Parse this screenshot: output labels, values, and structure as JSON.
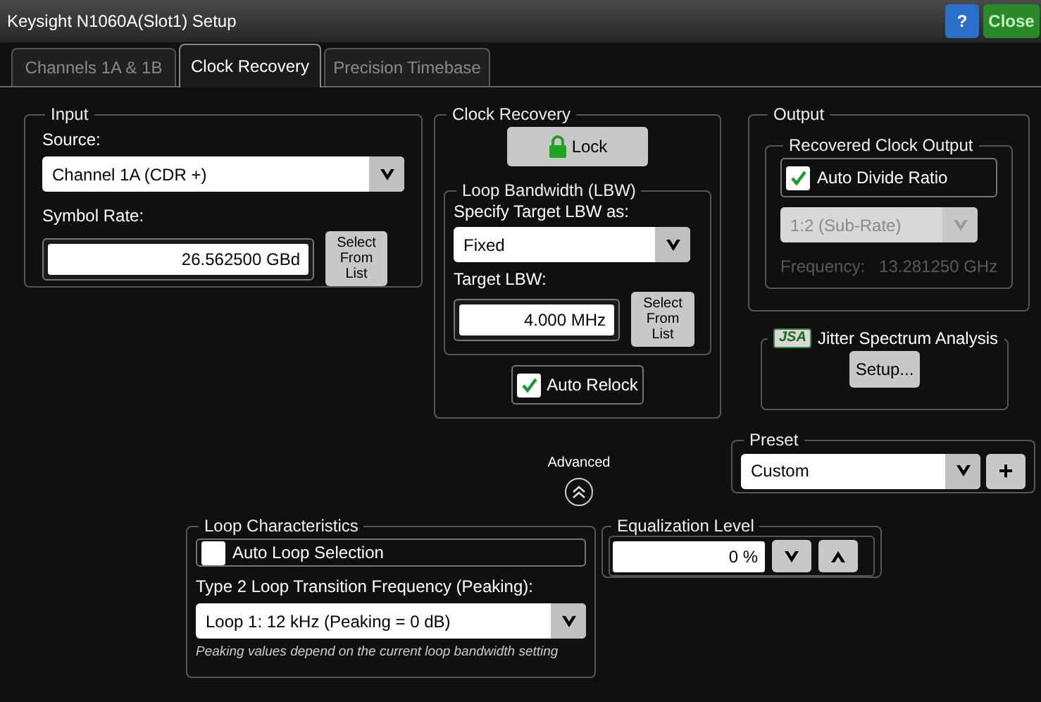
{
  "window": {
    "title": "Keysight N1060A(Slot1) Setup"
  },
  "title_buttons": [
    {
      "kind": "help",
      "label": "?"
    },
    {
      "kind": "close",
      "label": "Close"
    }
  ],
  "tabs": [
    {
      "label": "Channels 1A & 1B",
      "selected": false
    },
    {
      "label": "Clock Recovery",
      "selected": true
    },
    {
      "label": "Precision Timebase",
      "selected": false
    }
  ],
  "input": {
    "title": "Input",
    "source_label": "Source:",
    "source": "Channel 1A (CDR +)",
    "symbol_rate_label": "Symbol Rate:",
    "symbol_rate": "26.562500 GBd",
    "select_button": "Select From List"
  },
  "clock_recovery": {
    "title": "Clock Recovery",
    "lock_button": "Lock",
    "loop_bandwidth": {
      "title": "Loop Bandwidth (LBW)",
      "specify_label": "Specify Target LBW as:",
      "specify": "Fixed",
      "target_label": "Target LBW:",
      "target": "4.000 MHz",
      "select_button": "Select From List"
    },
    "auto_relock": {
      "label": "Auto Relock",
      "checked": true
    }
  },
  "output": {
    "title": "Output",
    "recovered_clock": {
      "title": "Recovered Clock Output",
      "auto_divide": {
        "label": "Auto Divide Ratio",
        "checked": true
      },
      "ratio": "1:2 (Sub-Rate)",
      "disabled": true,
      "frequency_label": "Frequency:",
      "frequency": "13.281250 GHz"
    }
  },
  "jsa": {
    "badge": "JSA",
    "title": "Jitter Spectrum Analysis",
    "setup_button": "Setup..."
  },
  "advanced": {
    "label": "Advanced"
  },
  "preset": {
    "title": "Preset",
    "value": "Custom",
    "add_button": "+"
  },
  "loop_characteristics": {
    "title": "Loop Characteristics",
    "auto_loop": {
      "label": "Auto Loop Selection",
      "checked": false
    },
    "type2_label": "Type 2 Loop Transition Frequency (Peaking):",
    "type2": "Loop 1: 12 kHz (Peaking = 0 dB)",
    "note": "Peaking values depend on the current loop bandwidth setting"
  },
  "equalization": {
    "title": "Equalization Level",
    "value": "0 %"
  }
}
